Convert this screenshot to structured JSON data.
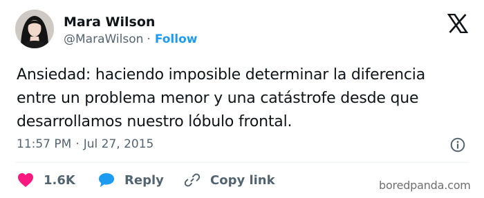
{
  "author": {
    "name": "Mara Wilson",
    "handle": "@MaraWilson",
    "separator": "·",
    "follow_label": "Follow"
  },
  "tweet": {
    "text": "Ansiedad: haciendo imposible determinar la diferencia\nentre un problema menor y una catástrofe desde que\ndesarrollamos nuestro lóbulo frontal."
  },
  "meta": {
    "time": "11:57 PM",
    "separator": "·",
    "date": "Jul 27, 2015"
  },
  "actions": {
    "like_count": "1.6K",
    "reply_label": "Reply",
    "copy_label": "Copy link"
  },
  "icons": {
    "platform": "x-logo-icon",
    "info": "info-icon",
    "like": "heart-icon",
    "reply": "speech-bubble-icon",
    "copy": "link-icon"
  },
  "colors": {
    "accent": "#1d9bf0",
    "like": "#f91880",
    "secondary_text": "#536471",
    "text": "#0f1419"
  },
  "watermark": {
    "text": "boredpanda.com"
  }
}
